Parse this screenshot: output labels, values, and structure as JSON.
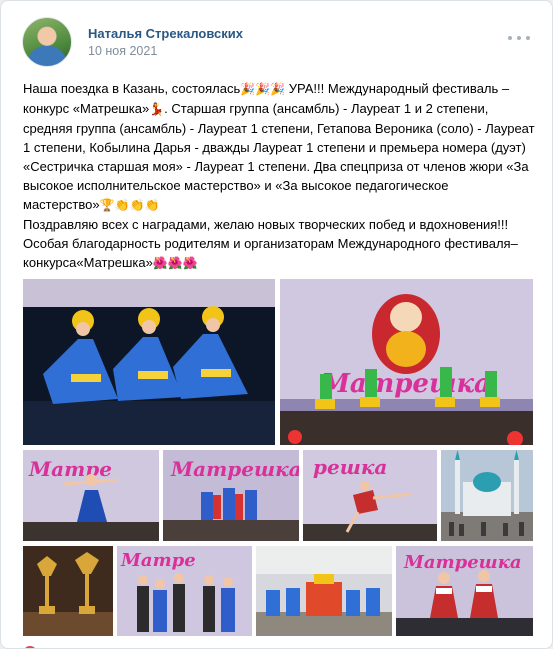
{
  "post": {
    "author": "Наталья Стрекаловских",
    "date": "10 ноя 2021",
    "menu_icon": "more-horizontal-icon",
    "text": {
      "p1": "Наша поездка в Казань, состоялась",
      "p2": " УРА!!! Международный фестиваль – конкурс «Матрешка»",
      "p3": ". Старшая группа (ансамбль) - Лауреат 1 и 2 степени, средняя группа (ансамбль) - Лауреат 1 степени, Гетапова Вероника (соло) - Лауреат 1 степени, Кобылина Дарья - дважды Лауреат 1 степени и премьера номера (дуэт) «Сестричка старшая моя» - Лауреат 1 степени. Два спецприза от членов жюри «За высокое исполнительское мастерство» и «За высокое педагогическое мастерство»",
      "p4": "\nПоздравляю всех с наградами, желаю новых творческих побед и вдохновения!!!\nОсобая благодарность родителям и организаторам Международного фестиваля–конкурса«Матрешка»",
      "emoji_party": "🎉🎉🎉",
      "emoji_dancer": "💃",
      "emoji_trophy_clap": "🏆👏👏👏",
      "emoji_flowers": "🌺🌺🌺"
    },
    "banner_word": "Матрешка",
    "banner_word_short": "Матре",
    "banner_word_end": "решка",
    "footer": {
      "like_icon": "heart-icon",
      "like_count": ""
    }
  },
  "colors": {
    "link": "#2a5885",
    "secondary": "#818c99",
    "banner_pink": "#d8319a",
    "stage_blue": "#1d3f7a"
  }
}
